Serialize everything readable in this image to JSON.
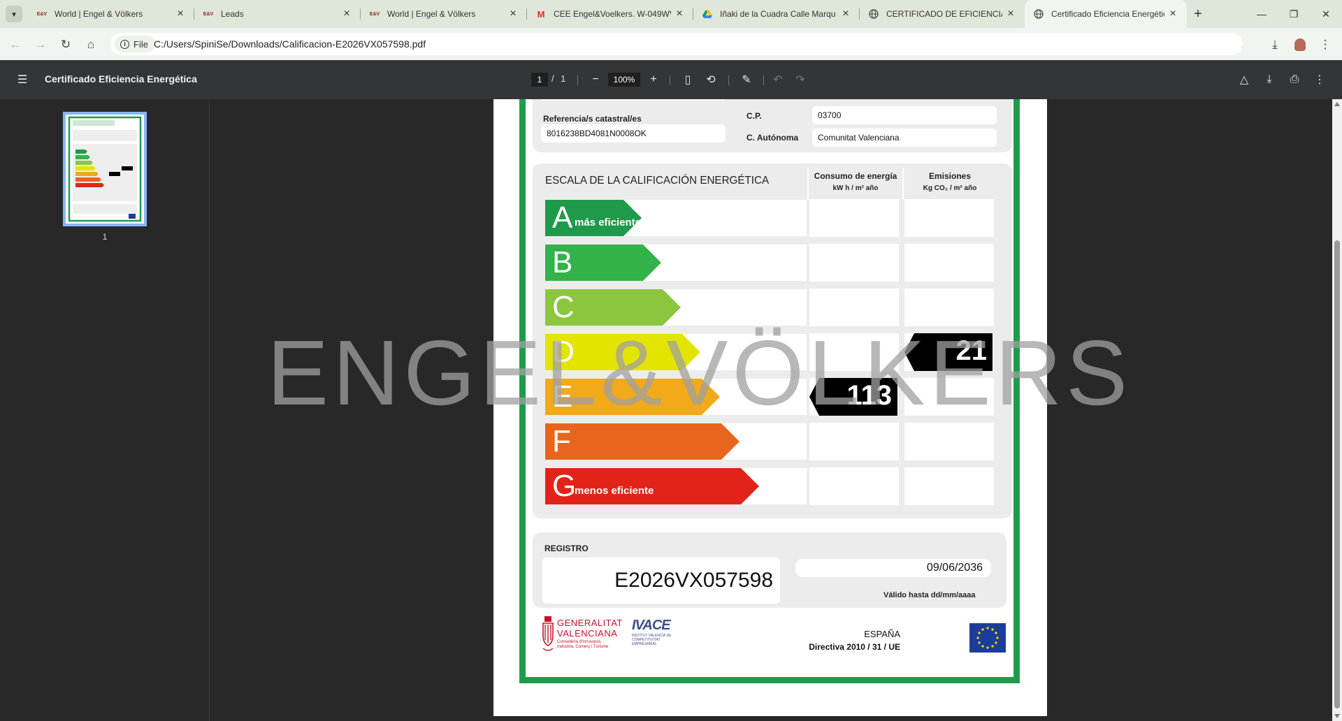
{
  "tabs": [
    {
      "title": "World | Engel & Völkers",
      "favicon": "engel-volkers-icon"
    },
    {
      "title": "Leads",
      "favicon": "engel-volkers-icon"
    },
    {
      "title": "World | Engel & Völkers",
      "favicon": "engel-volkers-icon"
    },
    {
      "title": "CEE Engel&Voelkers. W-049WV",
      "favicon": "gmail-icon"
    },
    {
      "title": "Iñaki de la Cuadra Calle Marqu",
      "favicon": "drive-icon"
    },
    {
      "title": "CERTIFICADO DE EFICIENCIA E",
      "favicon": "globe-icon"
    },
    {
      "title": "Certificado Eficiencia Energétic",
      "favicon": "globe-icon"
    }
  ],
  "address": {
    "scheme_chip": "File",
    "url": "C:/Users/SpiniSe/Downloads/Calificacion-E2026VX057598.pdf"
  },
  "pdf_toolbar": {
    "title": "Certificado Eficiencia Energética",
    "page_current": "1",
    "page_sep": "/",
    "page_total": "1",
    "zoom": "100%"
  },
  "sidebar": {
    "thumb_page": "1"
  },
  "certificate": {
    "ref_label": "Referencia/s catastral/es",
    "ref_value": "8016238BD4081N0008OK",
    "cp_label": "C.P.",
    "cp_value": "03700",
    "ca_label": "C. Autónoma",
    "ca_value": "Comunitat Valenciana",
    "scale_title": "ESCALA DE LA CALIFICACIÓN ENERGÉTICA",
    "col_energy_title": "Consumo de energía",
    "col_energy_unit": "kW h / m² año",
    "col_emissions_title": "Emisiones",
    "col_emissions_unit": "Kg CO₂ / m² año",
    "ratings": [
      {
        "letter": "A",
        "sub": "más eficiente",
        "color": "#1e9a4a"
      },
      {
        "letter": "B",
        "sub": "",
        "color": "#33b24a"
      },
      {
        "letter": "C",
        "sub": "",
        "color": "#8cc63f"
      },
      {
        "letter": "D",
        "sub": "",
        "color": "#e3e400"
      },
      {
        "letter": "E",
        "sub": "",
        "color": "#f2a91a"
      },
      {
        "letter": "F",
        "sub": "",
        "color": "#e8651e"
      },
      {
        "letter": "G",
        "sub": "menos eficiente",
        "color": "#e2231a"
      }
    ],
    "energy_value": "113",
    "energy_rating": "E",
    "emissions_value": "21",
    "emissions_rating": "D",
    "registro_label": "REGISTRO",
    "registro_value": "E2026VX057598",
    "valid_date": "09/06/2036",
    "valid_label": "Válido hasta dd/mm/aaaa",
    "gv_name_line1": "GENERALITAT",
    "gv_name_line2": "VALENCIANA",
    "gv_sub": "Conselleria d'Innovació, Indústria, Comerç i Turisme",
    "ivace": "IVACE",
    "ivace_sub": "INSTITUT VALENCIÀ DE COMPETITIVITAT EMPRESARIAL",
    "country": "ESPAÑA",
    "directive": "Directiva 2010 / 31 / UE"
  },
  "watermark": "ENGEL&VÖLKERS",
  "colors": {
    "frame_green": "#1f9b4d",
    "pdf_bar": "#323639",
    "tab_strip": "#dfe6da"
  }
}
